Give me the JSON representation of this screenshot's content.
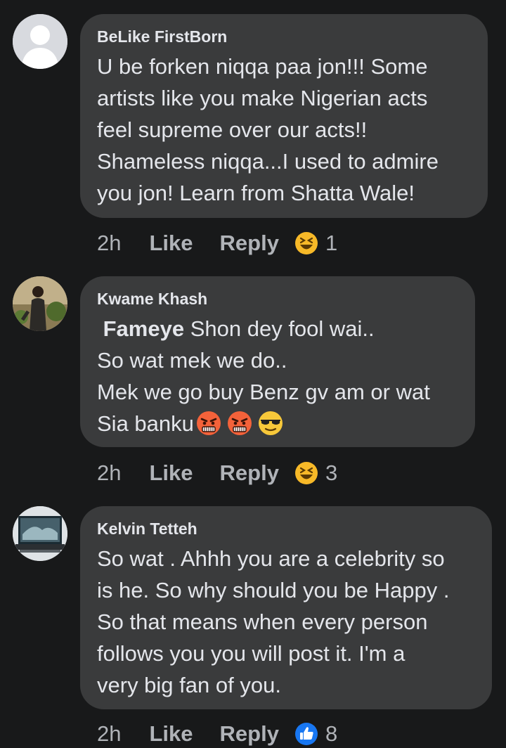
{
  "comments": [
    {
      "author": "BeLike FirstBorn",
      "text": "U be forken niqqa paa jon!!! Some\nartists like you make Nigerian acts\nfeel supreme over our acts!!\nShameless niqqa...I used to admire\nyou jon! Learn from Shatta Wale!",
      "time": "2h",
      "like_label": "Like",
      "reply_label": "Reply",
      "reaction": "haha",
      "reaction_count": "1",
      "avatar": "default-profile"
    },
    {
      "author": "Kwame Khash",
      "mention": "Fameye",
      "text": " Shon dey fool wai..\nSo wat mek we do..\nMek we go buy Benz gv am or wat\nSia banku",
      "emojis": [
        "angry-face",
        "angry-face",
        "sunglasses-face"
      ],
      "time": "2h",
      "like_label": "Like",
      "reply_label": "Reply",
      "reaction": "haha",
      "reaction_count": "3",
      "avatar": "person-photo"
    },
    {
      "author": "Kelvin Tetteh",
      "text": "So wat . Ahhh you are a celebrity so\nis he. So why should you be Happy .\nSo that means when every person\nfollows you you will post it. I'm a\nvery big fan of you.",
      "time": "2h",
      "like_label": "Like",
      "reply_label": "Reply",
      "reaction": "like",
      "reaction_count": "8",
      "avatar": "laptop-photo"
    }
  ],
  "colors": {
    "background": "#18191a",
    "bubble": "#3a3b3c",
    "text": "#e4e6eb",
    "secondary": "#b0b3b8",
    "like_blue": "#1877f2",
    "haha_yellow": "#f7b928"
  }
}
